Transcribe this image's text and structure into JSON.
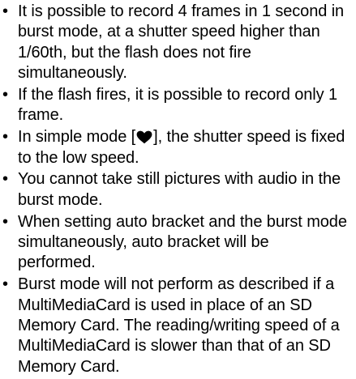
{
  "bullet_symbol": "•",
  "bullets": [
    {
      "text": "It is possible to record 4 frames in 1 second in burst mode, at a shutter speed higher than 1/60th, but the flash does not fire simultaneously."
    },
    {
      "text": "If the flash fires, it is possible to record only 1 frame."
    },
    {
      "text_before": "In simple mode [",
      "icon": "heart-icon",
      "text_after": "], the shutter speed is fixed to the low speed."
    },
    {
      "text": "You cannot take still pictures with audio in the burst mode."
    },
    {
      "text": "When setting auto bracket and the burst mode simultaneously, auto bracket will be performed."
    },
    {
      "text": "Burst mode will not perform as described if a MultiMediaCard is used in place of an SD Memory Card. The reading/writing speed of a MultiMediaCard is slower than that of an SD Memory Card."
    }
  ]
}
